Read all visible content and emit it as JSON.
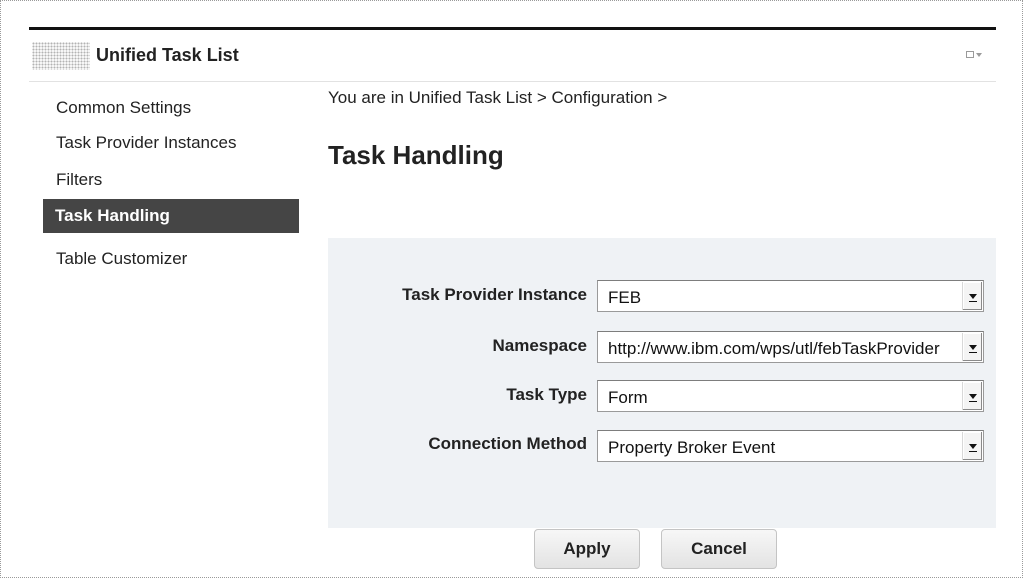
{
  "portlet": {
    "title": "Unified Task List",
    "menu_icon": "portlet-menu-icon"
  },
  "sidebar": {
    "items": [
      {
        "label": "Common Settings",
        "active": false
      },
      {
        "label": "Task Provider Instances",
        "active": false
      },
      {
        "label": "Filters",
        "active": false
      },
      {
        "label": "Task Handling",
        "active": true
      },
      {
        "label": "Table Customizer",
        "active": false
      }
    ]
  },
  "main": {
    "breadcrumb": "You are in Unified Task List > Configuration >",
    "title": "Task Handling"
  },
  "form": {
    "fields": [
      {
        "label": "Task Provider Instance",
        "value": "FEB"
      },
      {
        "label": "Namespace",
        "value": "http://www.ibm.com/wps/utl/febTaskProvider"
      },
      {
        "label": "Task Type",
        "value": "Form"
      },
      {
        "label": "Connection Method",
        "value": "Property Broker Event"
      }
    ]
  },
  "buttons": {
    "apply_label": "Apply",
    "cancel_label": "Cancel"
  },
  "colors": {
    "active_nav_bg": "#454545",
    "form_panel_bg": "#eff2f5",
    "header_rule": "#111111"
  }
}
